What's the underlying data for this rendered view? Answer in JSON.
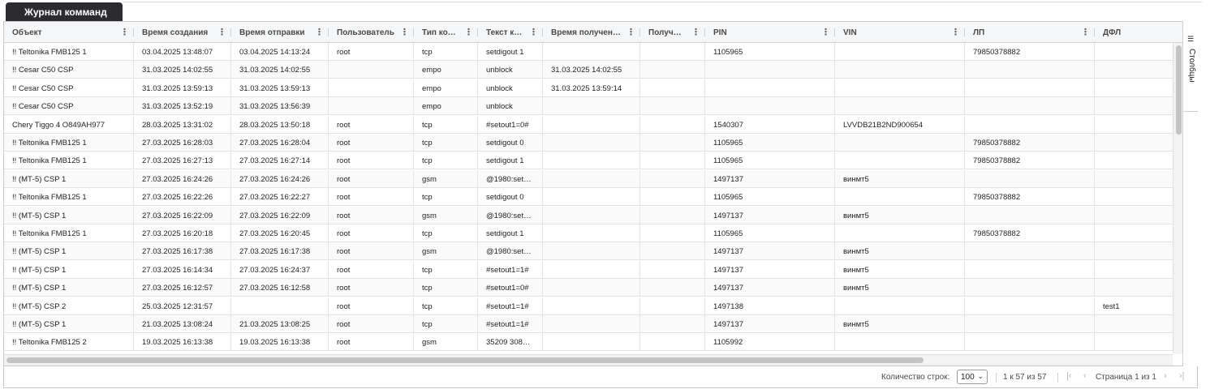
{
  "tab": {
    "title": "Журнал комманд"
  },
  "columns": [
    "Объект",
    "Время создания",
    "Время отправки",
    "Пользователь",
    "Тип ко…",
    "Текст к…",
    "Время получен…",
    "Получ…",
    "PIN",
    "VIN",
    "ЛП",
    "ДФЛ"
  ],
  "rows": [
    [
      "!! Teltonika FMB125 1",
      "03.04.2025 13:48:07",
      "03.04.2025 14:13:24",
      "root",
      "tcp",
      "setdigout 1",
      "",
      "",
      "1105965",
      "",
      "79850378882",
      ""
    ],
    [
      "!! Cesar C50 CSP",
      "31.03.2025 14:02:55",
      "31.03.2025 14:02:55",
      "",
      "empo",
      "unblock",
      "31.03.2025 14:02:55",
      "",
      "",
      "",
      "",
      ""
    ],
    [
      "!! Cesar C50 CSP",
      "31.03.2025 13:59:13",
      "31.03.2025 13:59:13",
      "",
      "empo",
      "unblock",
      "31.03.2025 13:59:14",
      "",
      "",
      "",
      "",
      ""
    ],
    [
      "!! Cesar C50 CSP",
      "31.03.2025 13:52:19",
      "31.03.2025 13:56:39",
      "",
      "empo",
      "unblock",
      "",
      "",
      "",
      "",
      "",
      ""
    ],
    [
      "Chery Tiggo 4 О849АН977",
      "28.03.2025 13:31:02",
      "28.03.2025 13:50:18",
      "root",
      "tcp",
      "#setout1=0#",
      "",
      "",
      "1540307",
      "LVVDB21B2ND900654",
      "",
      ""
    ],
    [
      "!! Teltonika FMB125 1",
      "27.03.2025 16:28:03",
      "27.03.2025 16:28:04",
      "root",
      "tcp",
      "setdigout 0",
      "",
      "",
      "1105965",
      "",
      "79850378882",
      ""
    ],
    [
      "!! Teltonika FMB125 1",
      "27.03.2025 16:27:13",
      "27.03.2025 16:27:14",
      "root",
      "tcp",
      "setdigout 1",
      "",
      "",
      "1105965",
      "",
      "79850378882",
      ""
    ],
    [
      "!! (МТ-5) CSP 1",
      "27.03.2025 16:24:26",
      "27.03.2025 16:24:26",
      "root",
      "gsm",
      "@1980:set…",
      "",
      "",
      "1497137",
      "винмт5",
      "",
      ""
    ],
    [
      "!! Teltonika FMB125 1",
      "27.03.2025 16:22:26",
      "27.03.2025 16:22:27",
      "root",
      "tcp",
      "setdigout 0",
      "",
      "",
      "1105965",
      "",
      "79850378882",
      ""
    ],
    [
      "!! (МТ-5) CSP 1",
      "27.03.2025 16:22:09",
      "27.03.2025 16:22:09",
      "root",
      "gsm",
      "@1980:set…",
      "",
      "",
      "1497137",
      "винмт5",
      "",
      ""
    ],
    [
      "!! Teltonika FMB125 1",
      "27.03.2025 16:20:18",
      "27.03.2025 16:20:45",
      "root",
      "tcp",
      "setdigout 1",
      "",
      "",
      "1105965",
      "",
      "79850378882",
      ""
    ],
    [
      "!! (МТ-5) CSP 1",
      "27.03.2025 16:17:38",
      "27.03.2025 16:17:38",
      "root",
      "gsm",
      "@1980:set…",
      "",
      "",
      "1497137",
      "винмт5",
      "",
      ""
    ],
    [
      "!! (МТ-5) CSP 1",
      "27.03.2025 16:14:34",
      "27.03.2025 16:24:37",
      "root",
      "tcp",
      "#setout1=1#",
      "",
      "",
      "1497137",
      "винмт5",
      "",
      ""
    ],
    [
      "!! (МТ-5) CSP 1",
      "27.03.2025 16:12:57",
      "27.03.2025 16:12:58",
      "root",
      "tcp",
      "#setout1=0#",
      "",
      "",
      "1497137",
      "винмт5",
      "",
      ""
    ],
    [
      "!! (МТ-5) CSP 2",
      "25.03.2025 12:31:57",
      "",
      "root",
      "tcp",
      "#setout1=1#",
      "",
      "",
      "1497138",
      "",
      "",
      "test1"
    ],
    [
      "!! (МТ-5) CSP 1",
      "21.03.2025 13:08:24",
      "21.03.2025 13:08:25",
      "root",
      "tcp",
      "#setout1=1#",
      "",
      "",
      "1497137",
      "винмт5",
      "",
      ""
    ],
    [
      "!! Teltonika FMB125 2",
      "19.03.2025 16:13:38",
      "19.03.2025 16:13:38",
      "root",
      "gsm",
      "35209 308…",
      "",
      "",
      "1105992",
      "",
      "",
      ""
    ]
  ],
  "side_panel": {
    "columns_label": "Столбцы"
  },
  "footer": {
    "rows_per_page_label": "Количество строк:",
    "rows_per_page_value": "100",
    "range_text": "1 к 57 из 57",
    "page_text": "Страница 1 из 1"
  },
  "icons": {
    "column_menu": "kebab-icon",
    "first_page": "first-page-icon",
    "prev_page": "prev-page-icon",
    "next_page": "next-page-icon",
    "last_page": "last-page-icon",
    "columns_panel": "columns-icon",
    "dropdown": "chevron-down-icon"
  },
  "colors": {
    "tab_background": "#2b2b30",
    "header_background": "#f5f6f7",
    "border": "#c9c9c9"
  }
}
